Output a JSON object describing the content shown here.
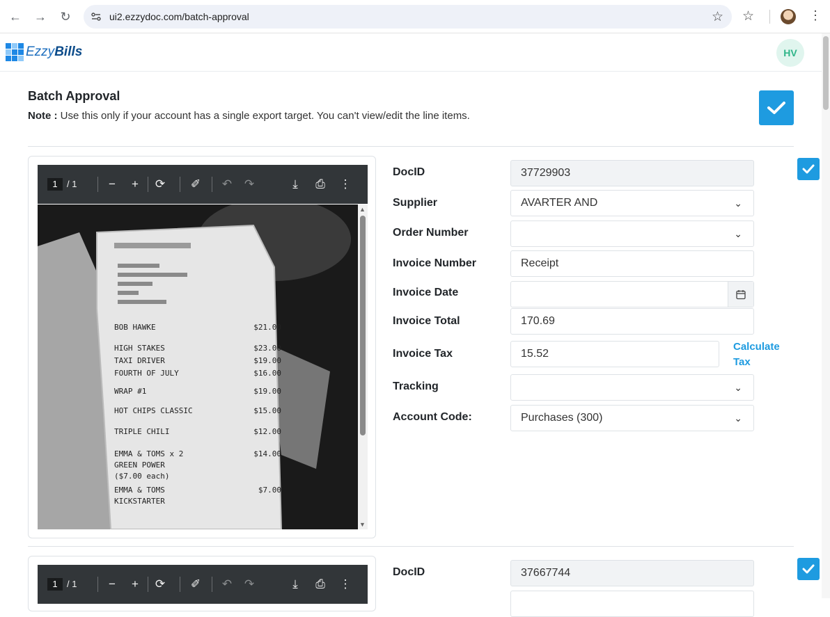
{
  "browser": {
    "url": "ui2.ezzydoc.com/batch-approval"
  },
  "app": {
    "logo_light": "Ezzy",
    "logo_bold": "Bills",
    "avatar_initials": "HV"
  },
  "page": {
    "title": "Batch Approval",
    "note_label": "Note :",
    "note_text": " Use this only if your account has a single export target. You can't view/edit the line items."
  },
  "colors": {
    "accent": "#1e9be0",
    "avatar_bg": "#e0f5ee",
    "avatar_fg": "#2fb589"
  },
  "documents": [
    {
      "viewer": {
        "page": "1",
        "total": "/ 1"
      },
      "receipt_lines": [
        {
          "item": "BOB HAWKE",
          "price": "$21.00"
        },
        {
          "item": "HIGH STAKES",
          "price": "$23.00"
        },
        {
          "item": "TAXI DRIVER",
          "price": "$19.00"
        },
        {
          "item": "FOURTH OF JULY",
          "price": "$16.00"
        },
        {
          "item": "WRAP #1",
          "price": "$19.00"
        },
        {
          "item": "HOT CHIPS CLASSIC",
          "price": "$15.00"
        },
        {
          "item": "TRIPLE CHILI",
          "price": "$12.00"
        },
        {
          "item": "EMMA & TOMS x 2",
          "price": "$14.00"
        },
        {
          "item": "GREEN POWER",
          "price": ""
        },
        {
          "item": "($7.00 each)",
          "price": ""
        },
        {
          "item": "EMMA & TOMS",
          "price": "$7.00"
        },
        {
          "item": "KICKSTARTER",
          "price": ""
        }
      ],
      "fields": {
        "docid_label": "DocID",
        "docid": "37729903",
        "supplier_label": "Supplier",
        "supplier": "AVARTER AND",
        "order_label": "Order Number",
        "order": "",
        "invoice_number_label": "Invoice Number",
        "invoice_number": "Receipt",
        "invoice_date_label": "Invoice Date",
        "invoice_date": "",
        "invoice_total_label": "Invoice Total",
        "invoice_total": "170.69",
        "invoice_tax_label": "Invoice Tax",
        "invoice_tax": "15.52",
        "calculate_tax": "Calculate Tax",
        "tracking_label": "Tracking",
        "tracking": "",
        "account_code_label": "Account Code:",
        "account_code": "Purchases (300)"
      }
    },
    {
      "viewer": {
        "page": "1",
        "total": "/ 1"
      },
      "fields": {
        "docid_label": "DocID",
        "docid": "37667744"
      }
    }
  ]
}
